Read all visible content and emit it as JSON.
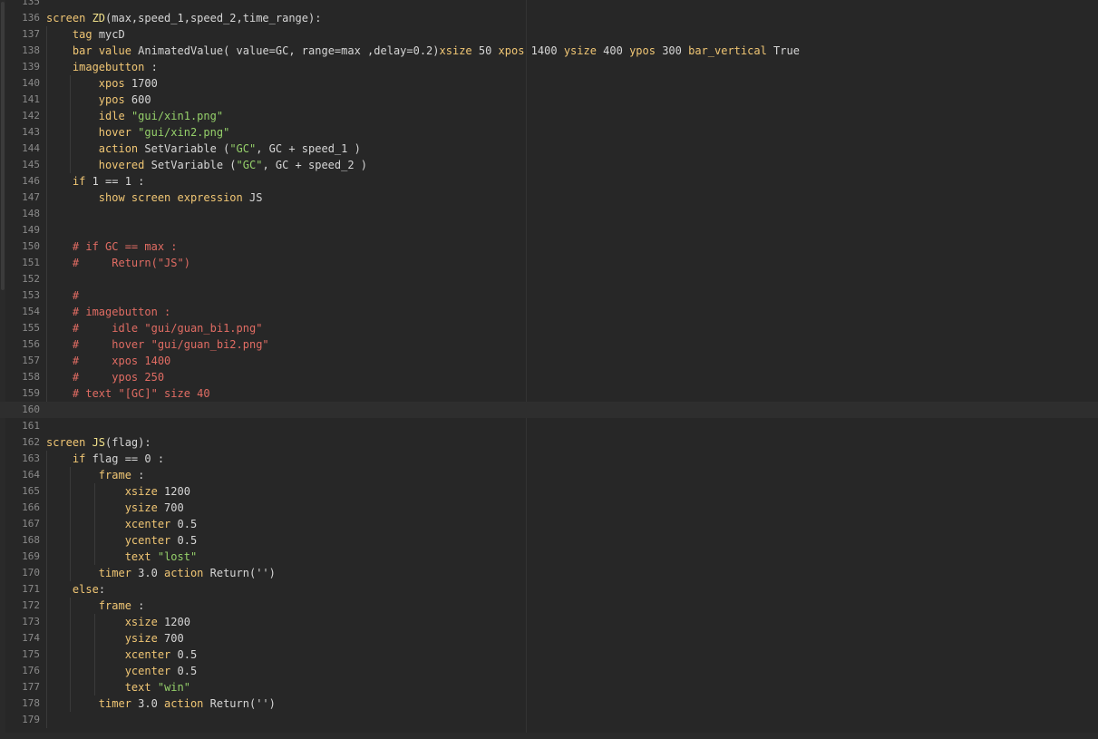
{
  "editor": {
    "lines": [
      {
        "n": "135",
        "seg": []
      },
      {
        "n": "136",
        "seg": [
          [
            "kw",
            "screen "
          ],
          [
            "fn",
            "ZD"
          ],
          [
            "",
            "(max,speed_1,speed_2,time_range):"
          ]
        ]
      },
      {
        "n": "137",
        "seg": [
          [
            "",
            "    "
          ],
          [
            "kw",
            "tag"
          ],
          [
            "",
            " mycD"
          ]
        ]
      },
      {
        "n": "138",
        "seg": [
          [
            "",
            "    "
          ],
          [
            "kw",
            "bar"
          ],
          [
            "",
            " "
          ],
          [
            "kw",
            "value"
          ],
          [
            "",
            " AnimatedValue( value=GC, range=max ,delay=0.2)"
          ],
          [
            "kw",
            "xsize"
          ],
          [
            "",
            " 50 "
          ],
          [
            "kw",
            "xpos"
          ],
          [
            "",
            " 1400 "
          ],
          [
            "kw",
            "ysize"
          ],
          [
            "",
            " 400 "
          ],
          [
            "kw",
            "ypos"
          ],
          [
            "",
            " 300 "
          ],
          [
            "kw",
            "bar_vertical"
          ],
          [
            "",
            " True"
          ]
        ]
      },
      {
        "n": "139",
        "seg": [
          [
            "",
            "    "
          ],
          [
            "kw",
            "imagebutton"
          ],
          [
            "",
            " :"
          ]
        ]
      },
      {
        "n": "140",
        "seg": [
          [
            "",
            "        "
          ],
          [
            "kw",
            "xpos"
          ],
          [
            "",
            " 1700"
          ]
        ]
      },
      {
        "n": "141",
        "seg": [
          [
            "",
            "        "
          ],
          [
            "kw",
            "ypos"
          ],
          [
            "",
            " 600"
          ]
        ]
      },
      {
        "n": "142",
        "seg": [
          [
            "",
            "        "
          ],
          [
            "kw",
            "idle"
          ],
          [
            "",
            " "
          ],
          [
            "str",
            "\"gui/xin1.png\""
          ]
        ]
      },
      {
        "n": "143",
        "seg": [
          [
            "",
            "        "
          ],
          [
            "kw",
            "hover"
          ],
          [
            "",
            " "
          ],
          [
            "str",
            "\"gui/xin2.png\""
          ]
        ]
      },
      {
        "n": "144",
        "seg": [
          [
            "",
            "        "
          ],
          [
            "kw",
            "action"
          ],
          [
            "",
            " SetVariable ("
          ],
          [
            "str",
            "\"GC\""
          ],
          [
            "",
            ", GC + speed_1 )"
          ]
        ]
      },
      {
        "n": "145",
        "seg": [
          [
            "",
            "        "
          ],
          [
            "kw",
            "hovered"
          ],
          [
            "",
            " SetVariable ("
          ],
          [
            "str",
            "\"GC\""
          ],
          [
            "",
            ", GC + speed_2 )"
          ]
        ]
      },
      {
        "n": "146",
        "seg": [
          [
            "",
            "    "
          ],
          [
            "kw",
            "if"
          ],
          [
            "",
            " 1 == 1 :"
          ]
        ]
      },
      {
        "n": "147",
        "seg": [
          [
            "",
            "        "
          ],
          [
            "kw",
            "show screen expression"
          ],
          [
            "",
            " JS"
          ]
        ]
      },
      {
        "n": "148",
        "seg": []
      },
      {
        "n": "149",
        "seg": []
      },
      {
        "n": "150",
        "seg": [
          [
            "",
            "    "
          ],
          [
            "cmt",
            "# if GC == max :"
          ]
        ]
      },
      {
        "n": "151",
        "seg": [
          [
            "",
            "    "
          ],
          [
            "cmt",
            "#     Return(\"JS\")"
          ]
        ]
      },
      {
        "n": "152",
        "seg": []
      },
      {
        "n": "153",
        "seg": [
          [
            "",
            "    "
          ],
          [
            "cmt",
            "#"
          ]
        ]
      },
      {
        "n": "154",
        "seg": [
          [
            "",
            "    "
          ],
          [
            "cmt",
            "# imagebutton :"
          ]
        ]
      },
      {
        "n": "155",
        "seg": [
          [
            "",
            "    "
          ],
          [
            "cmt",
            "#     idle \"gui/guan_bi1.png\""
          ]
        ]
      },
      {
        "n": "156",
        "seg": [
          [
            "",
            "    "
          ],
          [
            "cmt",
            "#     hover \"gui/guan_bi2.png\""
          ]
        ]
      },
      {
        "n": "157",
        "seg": [
          [
            "",
            "    "
          ],
          [
            "cmt",
            "#     xpos 1400"
          ]
        ]
      },
      {
        "n": "158",
        "seg": [
          [
            "",
            "    "
          ],
          [
            "cmt",
            "#     ypos 250"
          ]
        ]
      },
      {
        "n": "159",
        "seg": [
          [
            "",
            "    "
          ],
          [
            "cmt",
            "# text \"[GC]\" size 40"
          ]
        ]
      },
      {
        "n": "160",
        "seg": [],
        "current": true
      },
      {
        "n": "161",
        "seg": []
      },
      {
        "n": "162",
        "seg": [
          [
            "kw",
            "screen "
          ],
          [
            "fn",
            "JS"
          ],
          [
            "",
            "(flag):"
          ]
        ]
      },
      {
        "n": "163",
        "seg": [
          [
            "",
            "    "
          ],
          [
            "kw",
            "if"
          ],
          [
            "",
            " flag == 0 :"
          ]
        ]
      },
      {
        "n": "164",
        "seg": [
          [
            "",
            "        "
          ],
          [
            "kw",
            "frame"
          ],
          [
            "",
            " :"
          ]
        ]
      },
      {
        "n": "165",
        "seg": [
          [
            "",
            "            "
          ],
          [
            "kw",
            "xsize"
          ],
          [
            "",
            " 1200"
          ]
        ]
      },
      {
        "n": "166",
        "seg": [
          [
            "",
            "            "
          ],
          [
            "kw",
            "ysize"
          ],
          [
            "",
            " 700"
          ]
        ]
      },
      {
        "n": "167",
        "seg": [
          [
            "",
            "            "
          ],
          [
            "kw",
            "xcenter"
          ],
          [
            "",
            " 0.5"
          ]
        ]
      },
      {
        "n": "168",
        "seg": [
          [
            "",
            "            "
          ],
          [
            "kw",
            "ycenter"
          ],
          [
            "",
            " 0.5"
          ]
        ]
      },
      {
        "n": "169",
        "seg": [
          [
            "",
            "            "
          ],
          [
            "kw",
            "text"
          ],
          [
            "",
            " "
          ],
          [
            "str",
            "\"lost\""
          ]
        ]
      },
      {
        "n": "170",
        "seg": [
          [
            "",
            "        "
          ],
          [
            "kw",
            "timer"
          ],
          [
            "",
            " 3.0 "
          ],
          [
            "kw",
            "action"
          ],
          [
            "",
            " Return('')"
          ]
        ]
      },
      {
        "n": "171",
        "seg": [
          [
            "",
            "    "
          ],
          [
            "kw",
            "else"
          ],
          [
            "",
            ":"
          ]
        ]
      },
      {
        "n": "172",
        "seg": [
          [
            "",
            "        "
          ],
          [
            "kw",
            "frame"
          ],
          [
            "",
            " :"
          ]
        ]
      },
      {
        "n": "173",
        "seg": [
          [
            "",
            "            "
          ],
          [
            "kw",
            "xsize"
          ],
          [
            "",
            " 1200"
          ]
        ]
      },
      {
        "n": "174",
        "seg": [
          [
            "",
            "            "
          ],
          [
            "kw",
            "ysize"
          ],
          [
            "",
            " 700"
          ]
        ]
      },
      {
        "n": "175",
        "seg": [
          [
            "",
            "            "
          ],
          [
            "kw",
            "xcenter"
          ],
          [
            "",
            " 0.5"
          ]
        ]
      },
      {
        "n": "176",
        "seg": [
          [
            "",
            "            "
          ],
          [
            "kw",
            "ycenter"
          ],
          [
            "",
            " 0.5"
          ]
        ]
      },
      {
        "n": "177",
        "seg": [
          [
            "",
            "            "
          ],
          [
            "kw",
            "text"
          ],
          [
            "",
            " "
          ],
          [
            "str",
            "\"win\""
          ]
        ]
      },
      {
        "n": "178",
        "seg": [
          [
            "",
            "        "
          ],
          [
            "kw",
            "timer"
          ],
          [
            "",
            " 3.0 "
          ],
          [
            "kw",
            "action"
          ],
          [
            "",
            " Return('')"
          ]
        ]
      },
      {
        "n": "179",
        "seg": []
      }
    ]
  }
}
